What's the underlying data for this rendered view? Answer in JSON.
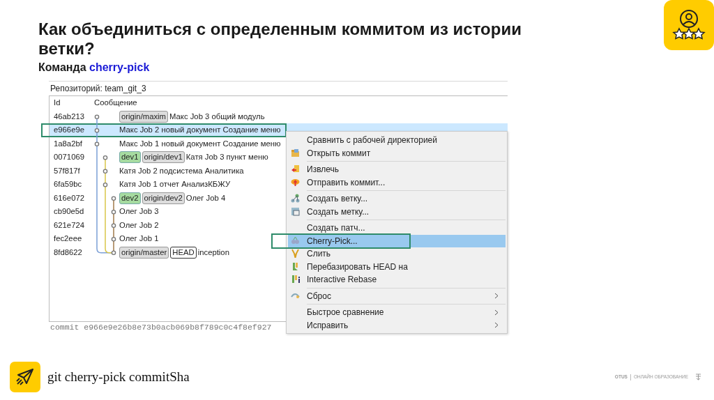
{
  "slide": {
    "title": "Как объединиться с определенным коммитом из истории ветки?",
    "subtitle": {
      "prefix": "Команда",
      "command": "cherry-pick"
    }
  },
  "window": {
    "repository": "Репозиторий: team_git_3",
    "columns": [
      "Id",
      "Сообщение"
    ],
    "commits": [
      {
        "id": "46ab213",
        "kind": "trunk",
        "refs": [
          {
            "label": "origin/maxim",
            "kind": "remote"
          }
        ],
        "message": "Макс Job 3 общий модуль",
        "selected": false,
        "highlighted": false
      },
      {
        "id": "e966e9e",
        "kind": "trunk",
        "message": "Макс Job 2 новый документ Создание меню",
        "selected": true,
        "highlighted": true
      },
      {
        "id": "1a8a2bf",
        "kind": "trunk",
        "message": "Макс Job 1 новый документ Создание меню",
        "selected": false,
        "highlighted": false
      },
      {
        "id": "0071069",
        "kind": "side",
        "refs": [
          {
            "label": "dev1",
            "kind": "local"
          },
          {
            "label": "origin/dev1",
            "kind": "remote"
          }
        ],
        "message": "Катя Job 3 пункт меню",
        "selected": false,
        "highlighted": false
      },
      {
        "id": "57f817f",
        "kind": "side",
        "message": "Катя Job 2 подсистема Аналитика",
        "selected": false,
        "highlighted": false
      },
      {
        "id": "6fa59bc",
        "kind": "side",
        "message": "Катя Job 1 отчет АнализКБЖУ",
        "selected": false,
        "highlighted": false
      },
      {
        "id": "616e072",
        "kind": "inner",
        "refs": [
          {
            "label": "dev2",
            "kind": "local"
          },
          {
            "label": "origin/dev2",
            "kind": "remote"
          }
        ],
        "message": "Олег Job 4",
        "selected": false,
        "highlighted": false
      },
      {
        "id": "cb90e5d",
        "kind": "inner",
        "message": "Олег Job 3",
        "selected": false,
        "highlighted": false
      },
      {
        "id": "621e724",
        "kind": "inner",
        "message": "Олег Job 2",
        "selected": false,
        "highlighted": false
      },
      {
        "id": "fec2eee",
        "kind": "inner",
        "message": "Олег Job 1",
        "selected": false,
        "highlighted": false
      },
      {
        "id": "8fd8622",
        "kind": "inner",
        "refs": [
          {
            "label": "origin/master",
            "kind": "remote"
          },
          {
            "label": "HEAD",
            "kind": "head"
          }
        ],
        "message": "inception",
        "selected": false,
        "highlighted": false
      }
    ],
    "commit_line": "commit e966e9e26b8e73b0acb069b8f789c0c4f8ef927",
    "context_menu": [
      [
        {
          "label": "Сравнить с рабочей директорией",
          "selected": false,
          "highlighted": false,
          "submenu": false
        },
        {
          "label": "Открыть коммит",
          "selected": false,
          "highlighted": false,
          "submenu": false
        }
      ],
      [
        {
          "label": "Извлечь",
          "selected": false,
          "highlighted": false,
          "submenu": false
        },
        {
          "label": "Отправить коммит...",
          "selected": false,
          "highlighted": false,
          "submenu": false
        }
      ],
      [
        {
          "label": "Создать ветку...",
          "selected": false,
          "highlighted": false,
          "submenu": false
        },
        {
          "label": "Создать метку...",
          "selected": false,
          "highlighted": false,
          "submenu": false
        }
      ],
      [
        {
          "label": "Создать патч...",
          "selected": false,
          "highlighted": false,
          "submenu": false
        },
        {
          "label": "Cherry-Pick...",
          "selected": true,
          "highlighted": true,
          "submenu": false
        },
        {
          "label": "Слить",
          "selected": false,
          "highlighted": false,
          "submenu": false
        },
        {
          "label": "Перебазировать HEAD на",
          "selected": false,
          "highlighted": false,
          "submenu": false
        },
        {
          "label": "Interactive Rebase",
          "selected": false,
          "highlighted": false,
          "submenu": false
        }
      ],
      [
        {
          "label": "Сброс",
          "selected": false,
          "highlighted": false,
          "submenu": true
        }
      ],
      [
        {
          "label": "Быстрое сравнение",
          "selected": false,
          "highlighted": false,
          "submenu": true
        },
        {
          "label": "Исправить",
          "selected": false,
          "highlighted": false,
          "submenu": true
        }
      ]
    ]
  },
  "footer": {
    "command": "git cherry-pick commitSha",
    "brand": "OTUS",
    "tagline": "ОНЛАЙН ОБРАЗОВАНИЕ"
  }
}
